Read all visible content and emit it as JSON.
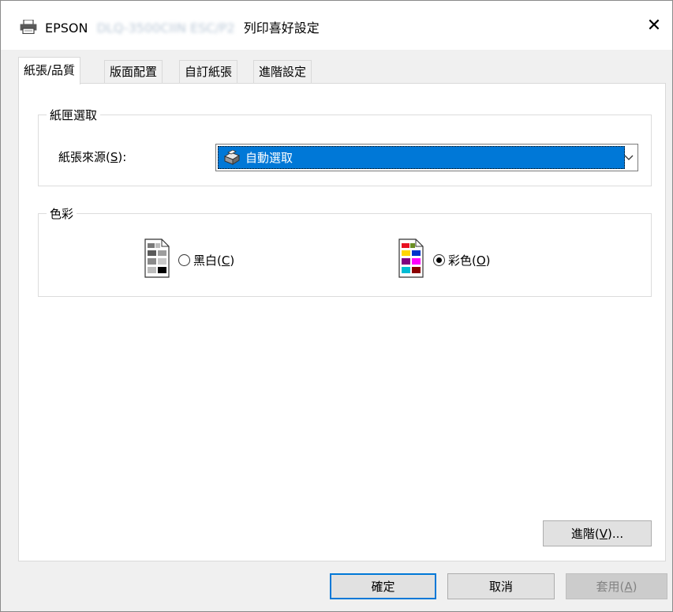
{
  "window": {
    "title_prefix": "EPSON",
    "title_model": "DLQ-3500CIIN ESC/P2",
    "title_suffix": "列印喜好設定",
    "close_glyph": "✕"
  },
  "tabs": [
    {
      "label": "紙張/品質",
      "active": true
    },
    {
      "label": "版面配置",
      "active": false
    },
    {
      "label": "自訂紙張",
      "active": false
    },
    {
      "label": "進階設定",
      "active": false
    }
  ],
  "paper_group": {
    "title": "紙匣選取",
    "source_label_pre": "紙張來源(",
    "source_label_key": "S",
    "source_label_post": "):",
    "source_value": "自動選取"
  },
  "color_group": {
    "title": "色彩",
    "bw_label_pre": "黑白(",
    "bw_label_key": "C",
    "bw_label_post": ")",
    "color_label_pre": "彩色(",
    "color_label_key": "O",
    "color_label_post": ")",
    "selected": "color"
  },
  "advanced_button": {
    "pre": "進階(",
    "key": "V",
    "post": ")..."
  },
  "footer": {
    "ok_label": "確定",
    "cancel_label": "取消",
    "apply_pre": "套用(",
    "apply_key": "A",
    "apply_post": ")"
  },
  "colors": {
    "accent": "#0078d7",
    "swatch_color": [
      "#e81123",
      "#6b8e23",
      "#ffd700",
      "#0033cc",
      "#800080",
      "#ff00ff",
      "#00bcd4",
      "#8b0000"
    ],
    "swatch_gray": [
      "#7a7a7a",
      "#bdbdbd",
      "#5a5a5a",
      "#9e9e9e",
      "#8a8a8a",
      "#000000"
    ]
  }
}
